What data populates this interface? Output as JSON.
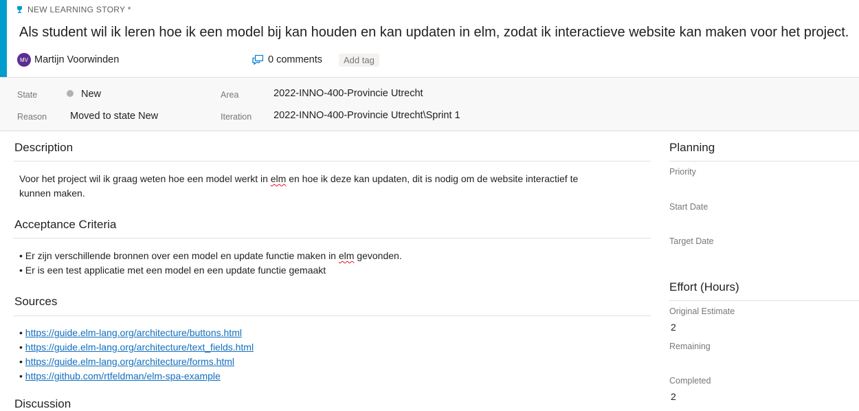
{
  "header": {
    "type_label": "NEW LEARNING STORY *",
    "title": "Als student wil ik leren hoe ik een model bij kan houden en kan updaten in elm, zodat ik interactieve website kan maken voor het project.",
    "assignee_initials": "MV",
    "assignee_name": "Martijn Voorwinden",
    "comments_label": "0 comments",
    "add_tag_label": "Add tag",
    "accent_color": "#009ccc",
    "avatar_color": "#5c2d91"
  },
  "fields": {
    "state_label": "State",
    "state_value": "New",
    "reason_label": "Reason",
    "reason_value": "Moved to state New",
    "area_label": "Area",
    "area_value": "2022-INNO-400-Provincie Utrecht",
    "iteration_label": "Iteration",
    "iteration_value": "2022-INNO-400-Provincie Utrecht\\Sprint 1"
  },
  "description": {
    "title": "Description",
    "line1_a": "Voor het project wil ik graag weten hoe een model werkt in ",
    "line1_flag": "elm",
    "line1_b": " en hoe ik deze kan updaten, dit is nodig om de website interactief te",
    "line2": "kunnen maken."
  },
  "acceptance": {
    "title": "Acceptance Criteria",
    "item1_a": "Er zijn verschillende bronnen over een model en update functie maken in ",
    "item1_flag": "elm",
    "item1_b": " gevonden.",
    "item2": "Er is een test applicatie met een model en een update functie gemaakt"
  },
  "sources": {
    "title": "Sources",
    "links": [
      "https://guide.elm-lang.org/architecture/buttons.html",
      "https://guide.elm-lang.org/architecture/text_fields.html",
      "https://guide.elm-lang.org/architecture/forms.html",
      "https://github.com/rtfeldman/elm-spa-example"
    ]
  },
  "next_section_partial": "Discussion",
  "planning": {
    "title": "Planning",
    "priority_label": "Priority",
    "start_date_label": "Start Date",
    "target_date_label": "Target Date"
  },
  "effort": {
    "title": "Effort (Hours)",
    "original_estimate_label": "Original Estimate",
    "original_estimate_value": "2",
    "remaining_label": "Remaining",
    "completed_label": "Completed",
    "completed_value": "2"
  }
}
